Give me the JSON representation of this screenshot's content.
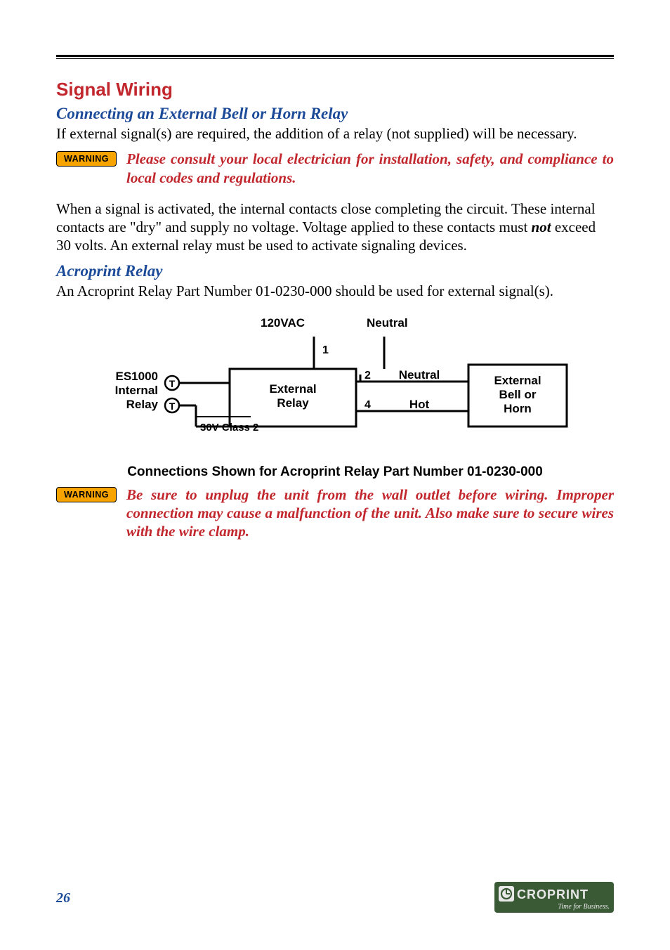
{
  "section_title": "Signal Wiring",
  "sub1_title": "Connecting an External Bell or Horn Relay",
  "sub1_p1": "If external signal(s) are required, the addition of a relay (not supplied) will be necessary.",
  "warning_label": "WARNING",
  "warn1_text": "Please consult your local electrician for installation, safety, and compliance to local codes and regulations.",
  "sub1_p2_pre": "When a signal is activated, the internal contacts close completing the circuit. These internal contacts are \"dry\" and supply no voltage. Voltage applied to these contacts must ",
  "sub1_p2_not": "not",
  "sub1_p2_post": " exceed 30 volts. An external relay must be used to activate signaling devices.",
  "sub2_title": "Acroprint Relay",
  "sub2_p1": "An Acroprint Relay Part Number 01-0230-000 should be used for external signal(s).",
  "diagram": {
    "ac_label": "120VAC",
    "neutral_top": "Neutral",
    "pin1": "1",
    "pin2": "2",
    "pin4": "4",
    "es1000_l1": "ES1000",
    "es1000_l2": "Internal",
    "es1000_l3": "Relay",
    "class2": "30V Class 2",
    "ext_relay_l1": "External",
    "ext_relay_l2": "Relay",
    "neutral": "Neutral",
    "hot": "Hot",
    "bell_l1": "External",
    "bell_l2": "Bell or",
    "bell_l3": "Horn"
  },
  "diagram_caption": "Connections Shown for Acroprint Relay Part Number 01-0230-000",
  "warn2_text": "Be sure to unplug the unit from the wall outlet before wiring. Improper connection may cause a malfunction of the unit. Also make sure to secure wires with the wire clamp.",
  "page_number": "26",
  "logo_brand": "CROPRINT",
  "logo_tag": "Time for Business."
}
